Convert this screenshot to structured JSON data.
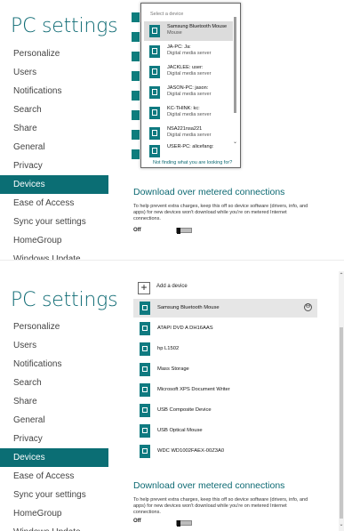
{
  "nav": {
    "title": "PC settings",
    "items": [
      {
        "label": "Personalize"
      },
      {
        "label": "Users"
      },
      {
        "label": "Notifications"
      },
      {
        "label": "Search"
      },
      {
        "label": "Share"
      },
      {
        "label": "General"
      },
      {
        "label": "Privacy"
      },
      {
        "label": "Devices",
        "selected": true
      },
      {
        "label": "Ease of Access"
      },
      {
        "label": "Sync your settings"
      },
      {
        "label": "HomeGroup"
      },
      {
        "label": "Windows Update"
      }
    ]
  },
  "popup": {
    "header": "Select a device",
    "items": [
      {
        "name": "Samsung Bluetooth Mouse",
        "sub": "Mouse",
        "selected": true
      },
      {
        "name": "JA-PC: Ja:",
        "sub": "Digital media server"
      },
      {
        "name": "JACKLEE: user:",
        "sub": "Digital media server"
      },
      {
        "name": "JASON-PC: jason:",
        "sub": "Digital media server"
      },
      {
        "name": "KC-THINK: kc:",
        "sub": "Digital media server"
      },
      {
        "name": "NSA221nsa221",
        "sub": "Digital media server"
      },
      {
        "name": "USER-PC: alicefang:",
        "sub": ""
      }
    ],
    "link": "Not finding what you are looking for?"
  },
  "devices": {
    "add_label": "Add a device",
    "remove_glyph": "⊖",
    "items": [
      {
        "label": "Samsung Bluetooth Mouse",
        "selected": true
      },
      {
        "label": "ATAPI DVD A  DH16AAS"
      },
      {
        "label": "hp L1502"
      },
      {
        "label": "Mass Storage"
      },
      {
        "label": "Microsoft XPS Document Writer"
      },
      {
        "label": "USB Composite Device"
      },
      {
        "label": "USB Optical Mouse"
      },
      {
        "label": "WDC WD1002FAEX-00Z3A0"
      }
    ]
  },
  "metered": {
    "heading": "Download over metered connections",
    "description": "To help prevent extra charges, keep this off so device software (drivers, info, and apps) for new devices won't download while you're on metered Internet connections.",
    "toggle_label": "Off",
    "toggle_on": false
  },
  "colors": {
    "accent": "#0b6e74",
    "title": "#0d6a73"
  }
}
